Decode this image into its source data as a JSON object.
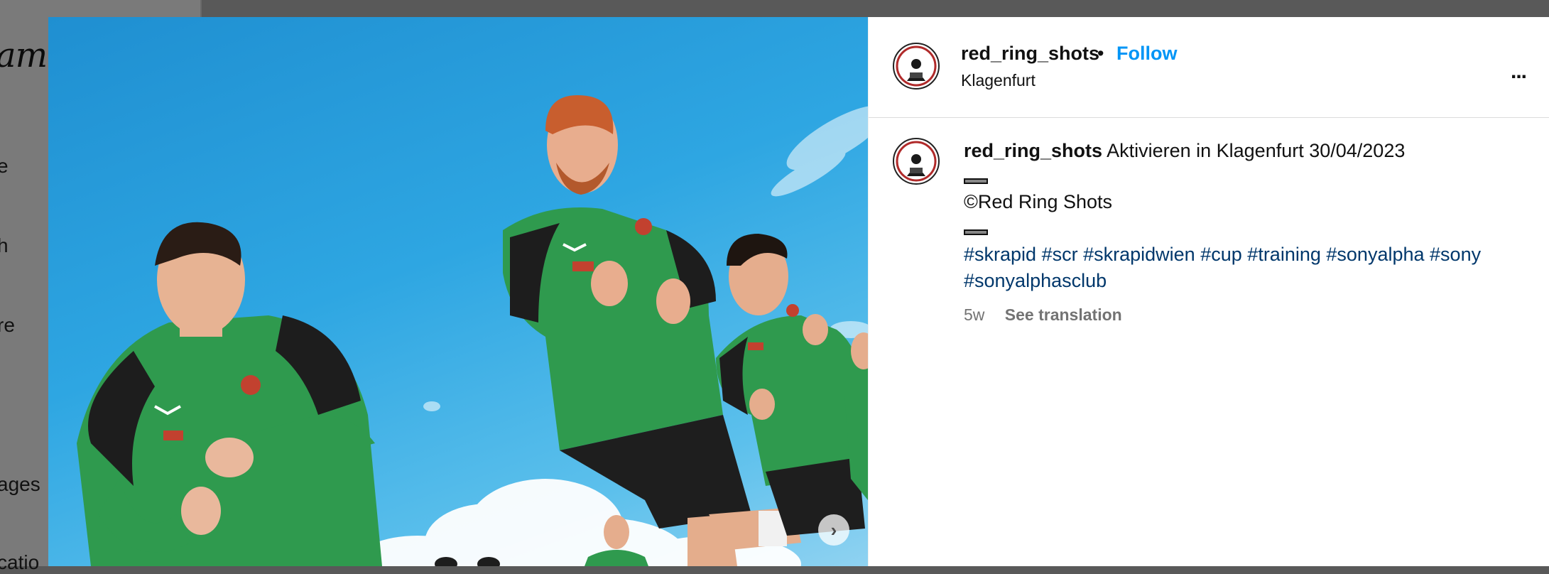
{
  "background": {
    "logo_fragment": "am",
    "nav_fragments": [
      "e",
      "h",
      "re",
      "ages",
      "catio"
    ]
  },
  "post": {
    "username": "red_ring_shots",
    "separator": "•",
    "follow_label": "Follow",
    "location": "Klagenfurt",
    "more_label": "...",
    "caption_text": "Aktivieren in Klagenfurt 30/04/2023",
    "copyright": "©Red Ring Shots",
    "hashtags": [
      "#skrapid",
      "#scr",
      "#skrapidwien",
      "#cup",
      "#training",
      "#sonyalpha",
      "#sony",
      "#sonyalphasclub"
    ],
    "age": "5w",
    "see_translation": "See translation",
    "next_icon": "chevron-right-icon"
  },
  "colors": {
    "follow": "#0095f6",
    "hashtag": "#00376b",
    "muted": "#737373",
    "jersey_green": "#2f9a4e"
  }
}
